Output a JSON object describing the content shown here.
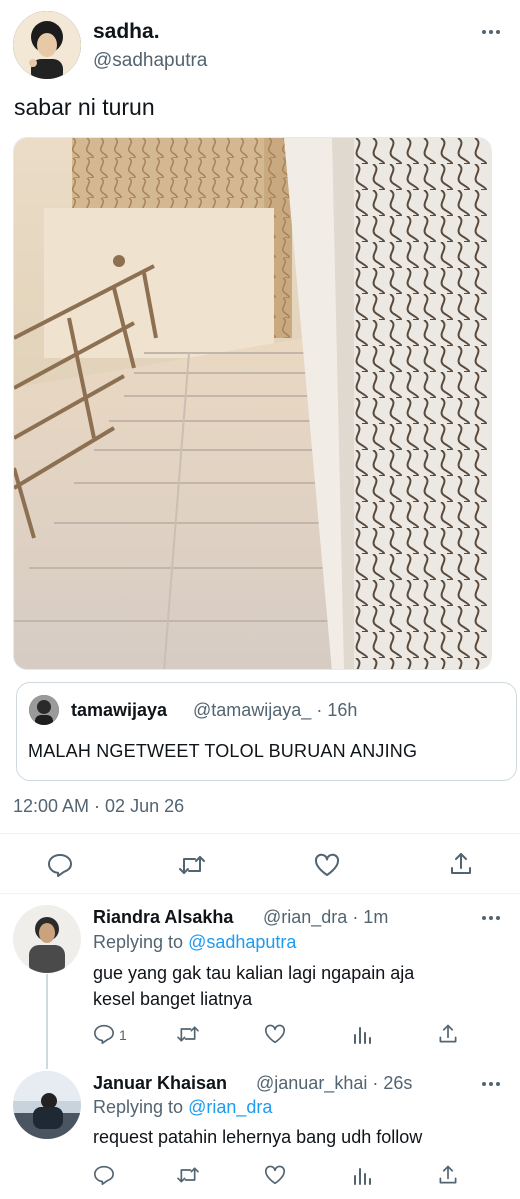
{
  "tweet": {
    "name": "sadha.",
    "handle": "@sadhaputra",
    "text": "sabar ni turun",
    "timestamp": "12:00 AM · 02 Jun 26"
  },
  "quote": {
    "name": "tamawijaya",
    "handle": "@tamawijaya_ · 16h",
    "text": "MALAH NGETWEET TOLOL BURUAN ANJING"
  },
  "replies": [
    {
      "name": "Riandra Alsakha",
      "handle": "@rian_dra · 1m",
      "replying_prefix": "Replying to ",
      "replying_to": "@sadhaputra",
      "text_line1": "gue yang gak tau kalian lagi ngapain aja",
      "text_line2": "kesel banget liatnya",
      "reply_count": "1"
    },
    {
      "name": "Januar Khaisan",
      "handle": "@januar_khai · 26s",
      "replying_prefix": "Replying to ",
      "replying_to": "@rian_dra",
      "text_line1": "request patahin lehernya bang udh follow"
    }
  ],
  "colors": {
    "accent": "#1d9bf0",
    "muted": "#536471",
    "text": "#0f1419"
  },
  "icons": [
    "more-icon",
    "reply-icon",
    "retweet-icon",
    "like-icon",
    "share-icon",
    "analytics-icon"
  ]
}
